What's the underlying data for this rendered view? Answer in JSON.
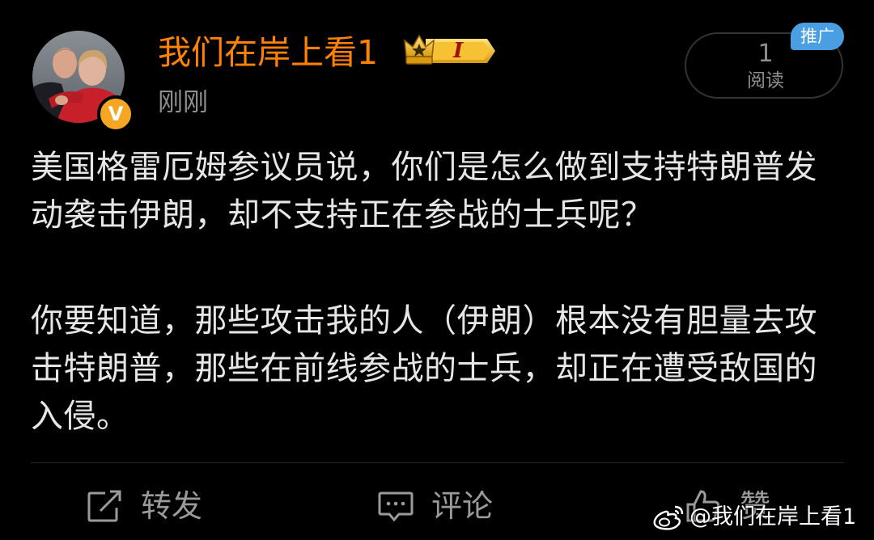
{
  "user": {
    "name": "我们在岸上看1",
    "level_label": "I",
    "time": "刚刚",
    "verified_mark": "V"
  },
  "stats": {
    "read_count": "1",
    "read_label": "阅读"
  },
  "promo_label": "推广",
  "post": {
    "paragraph_1": "美国格雷厄姆参议员说，你们是怎么做到支持特朗普发动袭击伊朗，却不支持正在参战的士兵呢？",
    "paragraph_2": "你要知道，那些攻击我的人（伊朗）根本没有胆量去攻击特朗普，那些在前线参战的士兵，却正在遭受敌国的入侵。"
  },
  "actions": {
    "repost_label": "转发",
    "comment_label": "评论",
    "like_label": "赞"
  },
  "watermark": {
    "text": "@我们在岸上看1"
  },
  "icons": {
    "repost": "share-icon",
    "comment": "comment-icon",
    "like": "thumbs-up-icon",
    "crown": "crown-icon",
    "weibo": "weibo-logo-icon"
  },
  "colors": {
    "background": "#000000",
    "username": "#ff8200",
    "text": "#e6e6e6",
    "muted": "#8f8f8f",
    "promo": "#4a9fe3",
    "verified": "#f5a623"
  }
}
